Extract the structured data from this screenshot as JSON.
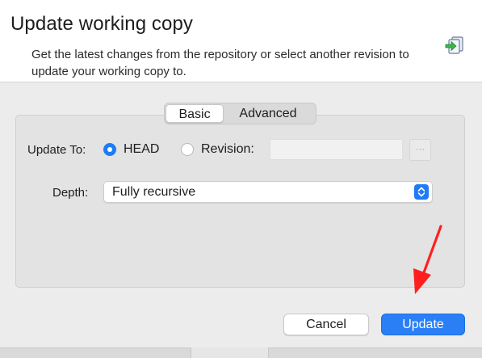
{
  "dialog": {
    "title": "Update working copy",
    "subtitle": "Get the latest changes from the repository or select another revision to update your working copy to.",
    "icon": "update-icon"
  },
  "tabs": [
    {
      "label": "Basic",
      "selected": true
    },
    {
      "label": "Advanced",
      "selected": false
    }
  ],
  "form": {
    "update_to_label": "Update To:",
    "head_label": "HEAD",
    "head_selected": true,
    "revision_label": "Revision:",
    "revision_value": "",
    "browse_label": "···",
    "depth_label": "Depth:",
    "depth_value": "Fully recursive"
  },
  "buttons": {
    "cancel": "Cancel",
    "update": "Update"
  },
  "colors": {
    "accent": "#1f7bf6",
    "annotation_arrow": "#ff1f1f"
  }
}
